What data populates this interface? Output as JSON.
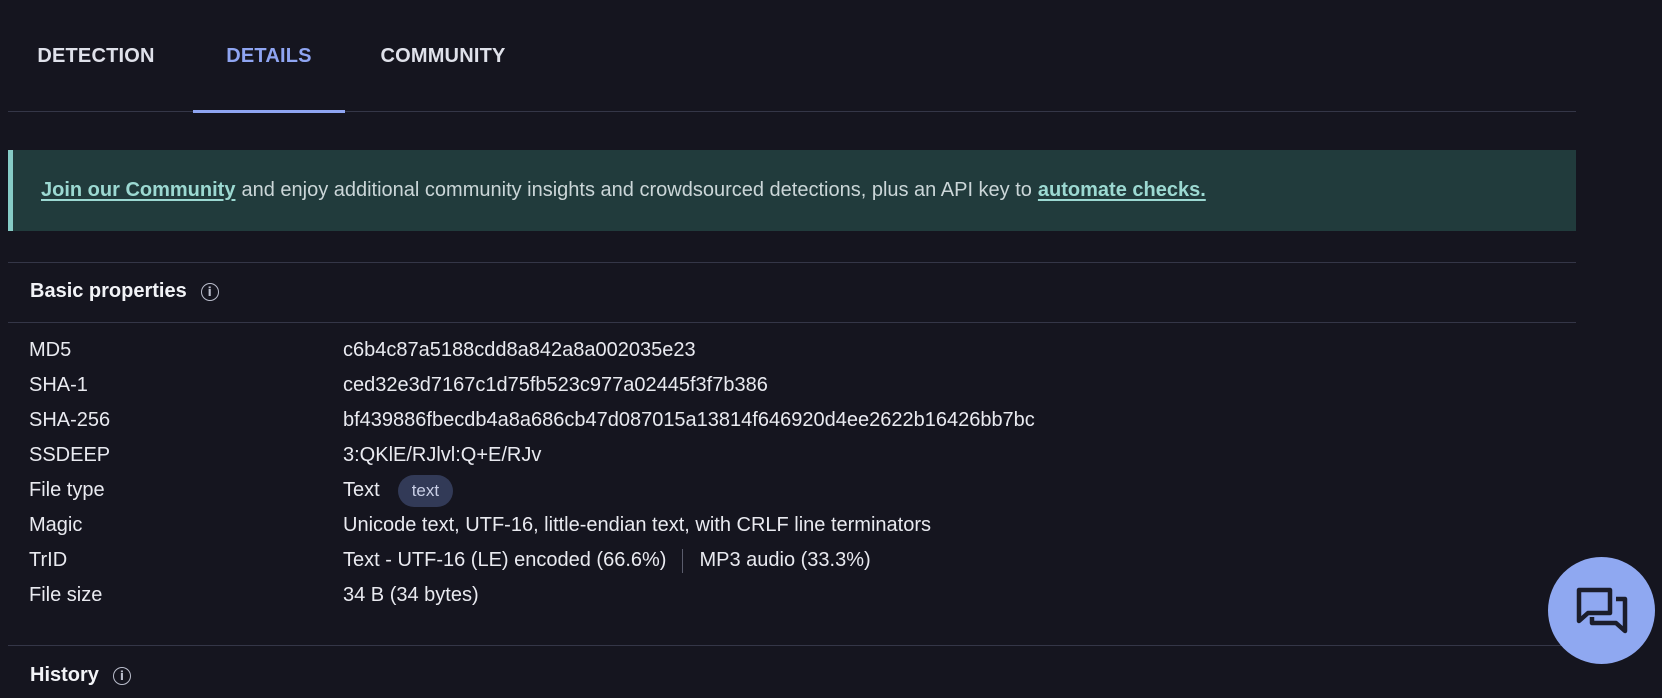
{
  "tabs": [
    {
      "label": "DETECTION",
      "active": false
    },
    {
      "label": "DETAILS",
      "active": true
    },
    {
      "label": "COMMUNITY",
      "active": false
    }
  ],
  "banner": {
    "link1": "Join our Community",
    "middle": "and enjoy additional community insights and crowdsourced detections, plus an API key to",
    "link2": "automate checks."
  },
  "basic": {
    "title": "Basic properties",
    "rows": {
      "md5": {
        "label": "MD5",
        "value": "c6b4c87a5188cdd8a842a8a002035e23"
      },
      "sha1": {
        "label": "SHA-1",
        "value": "ced32e3d7167c1d75fb523c977a02445f3f7b386"
      },
      "sha256": {
        "label": "SHA-256",
        "value": "bf439886fbecdb4a8a686cb47d087015a13814f646920d4ee2622b16426bb7bc"
      },
      "ssdeep": {
        "label": "SSDEEP",
        "value": "3:QKlE/RJlvl:Q+E/RJv"
      },
      "filetype": {
        "label": "File type",
        "value": "Text",
        "tag": "text"
      },
      "magic": {
        "label": "Magic",
        "value": "Unicode text, UTF-16, little-endian text, with CRLF line terminators"
      },
      "trid": {
        "label": "TrID",
        "value1": "Text - UTF-16 (LE) encoded (66.6%)",
        "value2": "MP3 audio (33.3%)"
      },
      "filesize": {
        "label": "File size",
        "value": "34 B (34 bytes)"
      }
    }
  },
  "history": {
    "title": "History"
  },
  "icons": {
    "info": "info-circle-icon",
    "chat": "chat-bubbles-icon"
  },
  "colors": {
    "accent": "#8fa5f2",
    "banner_bg": "#213b3c",
    "banner_link": "#9cd9d2",
    "background": "#15151f"
  }
}
